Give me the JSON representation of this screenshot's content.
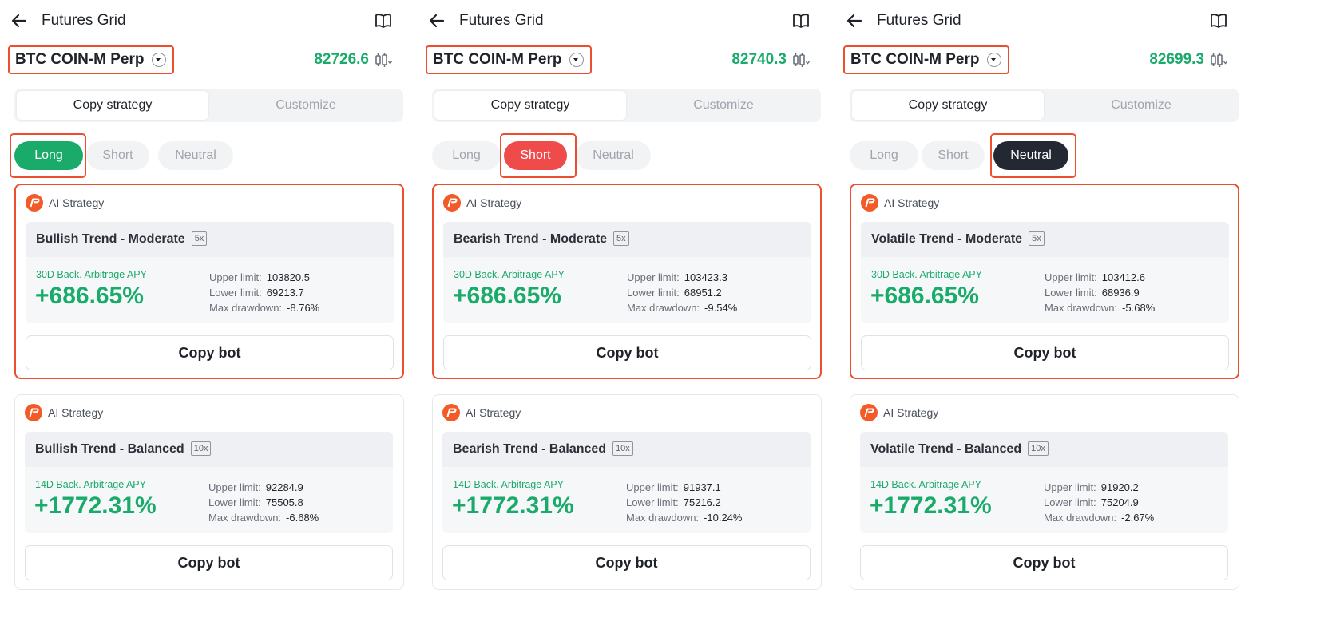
{
  "colors": {
    "accent_green": "#1aab6b",
    "short_red": "#ef4b4b",
    "neutral_dark": "#242833",
    "highlight_orange": "#ec4e2e",
    "ai_icon_orange": "#f25a27"
  },
  "icons": {
    "back": "arrow-left-icon",
    "guide": "book-icon",
    "pair_caret": "chevron-down-icon",
    "kline": "candlestick-settings-icon",
    "ai": "ai-strategy-logo-icon"
  },
  "panels": [
    {
      "title": "Futures Grid",
      "pair": "BTC COIN-M Perp",
      "price": "82726.6",
      "mode_tabs": [
        "Copy strategy",
        "Customize"
      ],
      "direction_tabs": [
        "Long",
        "Short",
        "Neutral"
      ],
      "selected_direction": "Long",
      "strategies": [
        {
          "source": "AI Strategy",
          "name": "Bullish Trend - Moderate",
          "leverage": "5x",
          "apy_label": "30D Back. Arbitrage APY",
          "apy": "+686.65%",
          "upper_label": "Upper limit:",
          "upper": "103820.5",
          "lower_label": "Lower limit:",
          "lower": "69213.7",
          "drawdown_label": "Max drawdown:",
          "drawdown": "-8.76%",
          "button": "Copy bot"
        },
        {
          "source": "AI Strategy",
          "name": "Bullish Trend - Balanced",
          "leverage": "10x",
          "apy_label": "14D Back. Arbitrage APY",
          "apy": "+1772.31%",
          "upper_label": "Upper limit:",
          "upper": "92284.9",
          "lower_label": "Lower limit:",
          "lower": "75505.8",
          "drawdown_label": "Max drawdown:",
          "drawdown": "-6.68%",
          "button": "Copy bot"
        }
      ]
    },
    {
      "title": "Futures Grid",
      "pair": "BTC COIN-M Perp",
      "price": "82740.3",
      "mode_tabs": [
        "Copy strategy",
        "Customize"
      ],
      "direction_tabs": [
        "Long",
        "Short",
        "Neutral"
      ],
      "selected_direction": "Short",
      "strategies": [
        {
          "source": "AI Strategy",
          "name": "Bearish Trend - Moderate",
          "leverage": "5x",
          "apy_label": "30D Back. Arbitrage APY",
          "apy": "+686.65%",
          "upper_label": "Upper limit:",
          "upper": "103423.3",
          "lower_label": "Lower limit:",
          "lower": "68951.2",
          "drawdown_label": "Max drawdown:",
          "drawdown": "-9.54%",
          "button": "Copy bot"
        },
        {
          "source": "AI Strategy",
          "name": "Bearish Trend - Balanced",
          "leverage": "10x",
          "apy_label": "14D Back. Arbitrage APY",
          "apy": "+1772.31%",
          "upper_label": "Upper limit:",
          "upper": "91937.1",
          "lower_label": "Lower limit:",
          "lower": "75216.2",
          "drawdown_label": "Max drawdown:",
          "drawdown": "-10.24%",
          "button": "Copy bot"
        }
      ]
    },
    {
      "title": "Futures Grid",
      "pair": "BTC COIN-M Perp",
      "price": "82699.3",
      "mode_tabs": [
        "Copy strategy",
        "Customize"
      ],
      "direction_tabs": [
        "Long",
        "Short",
        "Neutral"
      ],
      "selected_direction": "Neutral",
      "strategies": [
        {
          "source": "AI Strategy",
          "name": "Volatile Trend - Moderate",
          "leverage": "5x",
          "apy_label": "30D Back. Arbitrage APY",
          "apy": "+686.65%",
          "upper_label": "Upper limit:",
          "upper": "103412.6",
          "lower_label": "Lower limit:",
          "lower": "68936.9",
          "drawdown_label": "Max drawdown:",
          "drawdown": "-5.68%",
          "button": "Copy bot"
        },
        {
          "source": "AI Strategy",
          "name": "Volatile Trend - Balanced",
          "leverage": "10x",
          "apy_label": "14D Back. Arbitrage APY",
          "apy": "+1772.31%",
          "upper_label": "Upper limit:",
          "upper": "91920.2",
          "lower_label": "Lower limit:",
          "lower": "75204.9",
          "drawdown_label": "Max drawdown:",
          "drawdown": "-2.67%",
          "button": "Copy bot"
        }
      ]
    }
  ]
}
